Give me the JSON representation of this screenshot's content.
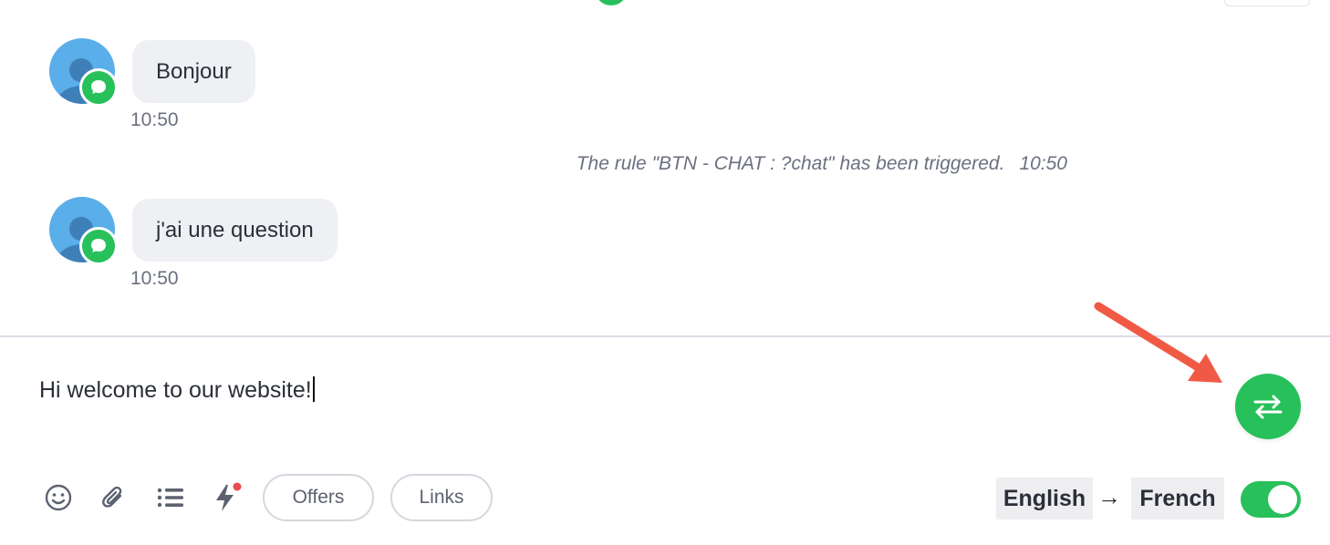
{
  "conversation": {
    "messages": [
      {
        "text": "Bonjour",
        "time": "10:50"
      },
      {
        "text": "j'ai une question",
        "time": "10:50"
      }
    ],
    "system_event": {
      "text": "The rule \"BTN - CHAT : ?chat\" has been triggered.",
      "time": "10:50"
    }
  },
  "composer": {
    "text": "Hi welcome to our website!"
  },
  "toolbar": {
    "icons": [
      "emoji-icon",
      "paperclip-icon",
      "list-icon",
      "lightning-icon"
    ],
    "offers_label": "Offers",
    "links_label": "Links"
  },
  "translation": {
    "source_language": "English",
    "arrow": "→",
    "target_language": "French",
    "enabled": true
  },
  "colors": {
    "accent_green": "#27c05a",
    "annotation_arrow": "#f05a45",
    "notification_dot": "#e84c4c",
    "bubble_bg": "#eff0f4"
  }
}
